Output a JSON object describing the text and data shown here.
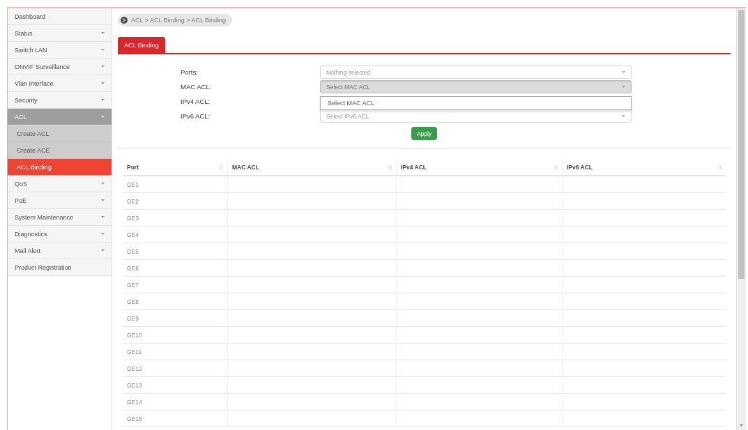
{
  "sidebar": {
    "items": [
      {
        "label": "Dashboard",
        "has_submenu": false,
        "expanded": false,
        "selected": false
      },
      {
        "label": "Status",
        "has_submenu": true,
        "expanded": false,
        "selected": false
      },
      {
        "label": "Switch LAN",
        "has_submenu": true,
        "expanded": false,
        "selected": false
      },
      {
        "label": "ONVIF Surveillance",
        "has_submenu": true,
        "expanded": false,
        "selected": false
      },
      {
        "label": "Vlan Interface",
        "has_submenu": true,
        "expanded": false,
        "selected": false
      },
      {
        "label": "Security",
        "has_submenu": true,
        "expanded": false,
        "selected": false
      },
      {
        "label": "ACL",
        "has_submenu": true,
        "expanded": true,
        "selected": false,
        "children": [
          {
            "label": "Create ACL",
            "selected": false
          },
          {
            "label": "Create ACE",
            "selected": false
          },
          {
            "label": "ACL Binding",
            "selected": true
          }
        ]
      },
      {
        "label": "QoS",
        "has_submenu": true,
        "expanded": false,
        "selected": false
      },
      {
        "label": "PoE",
        "has_submenu": true,
        "expanded": false,
        "selected": false
      },
      {
        "label": "System Maintenance",
        "has_submenu": true,
        "expanded": false,
        "selected": false
      },
      {
        "label": "Diagnostics",
        "has_submenu": true,
        "expanded": false,
        "selected": false
      },
      {
        "label": "Mail Alert",
        "has_submenu": true,
        "expanded": false,
        "selected": false
      },
      {
        "label": "Product Registration",
        "has_submenu": false,
        "expanded": false,
        "selected": false
      }
    ]
  },
  "breadcrumb": "ACL > ACL Binding > ACL Binding",
  "tabs": [
    {
      "label": "ACL Binding",
      "selected": true
    }
  ],
  "form": {
    "fields": [
      {
        "label": "Ports:",
        "placeholder": "Nothing selected",
        "open": false
      },
      {
        "label": "MAC ACL:",
        "value": "Select MAC ACL",
        "open": true,
        "options": [
          "Select MAC ACL"
        ]
      },
      {
        "label": "IPv4 ACL:"
      },
      {
        "label": "IPv6 ACL:",
        "value": "Select IPv6 ACL",
        "open": false
      }
    ],
    "apply_button": "Apply"
  },
  "table": {
    "columns": [
      "Port",
      "MAC ACL",
      "IPv4 ACL",
      "IPv6 ACL"
    ],
    "rows": [
      {
        "port": "GE1"
      },
      {
        "port": "GE2"
      },
      {
        "port": "GE3"
      },
      {
        "port": "GE4"
      },
      {
        "port": "GE5"
      },
      {
        "port": "GE6"
      },
      {
        "port": "GE7"
      },
      {
        "port": "GE8"
      },
      {
        "port": "GE9"
      },
      {
        "port": "GE10"
      },
      {
        "port": "GE11"
      },
      {
        "port": "GE12"
      },
      {
        "port": "GE13"
      },
      {
        "port": "GE14"
      },
      {
        "port": "GE15"
      }
    ]
  }
}
